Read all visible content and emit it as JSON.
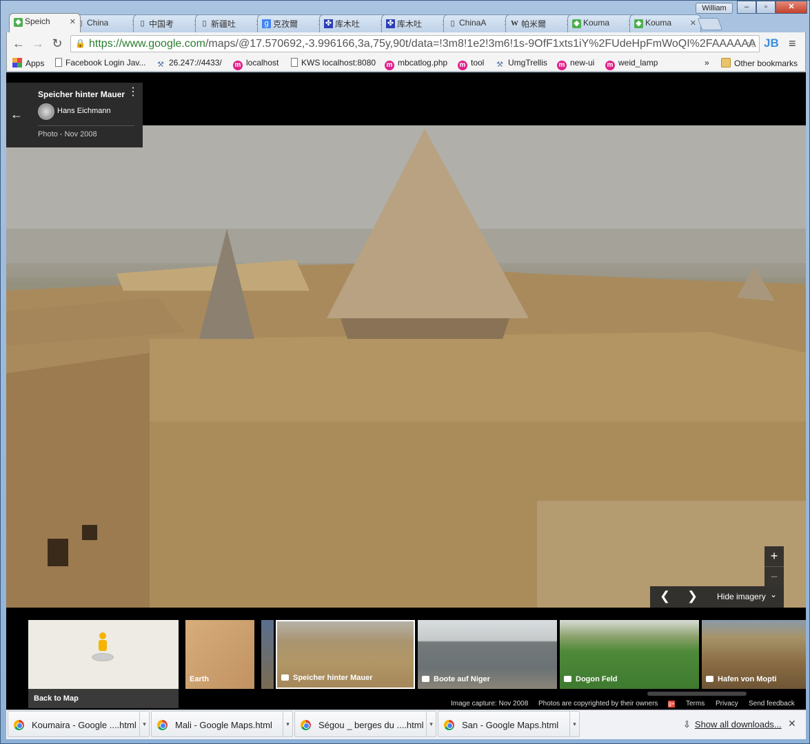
{
  "window": {
    "user": "William",
    "min": "–",
    "max": "▫",
    "close": "✕"
  },
  "tabs": [
    {
      "label": "Speich",
      "icon": "maps-icon",
      "active": true
    },
    {
      "label": "China",
      "icon": "page-icon"
    },
    {
      "label": "中国考",
      "icon": "page-icon"
    },
    {
      "label": "新疆吐",
      "icon": "page-icon"
    },
    {
      "label": "克孜爾",
      "icon": "google-icon"
    },
    {
      "label": "库木吐",
      "icon": "paw-icon"
    },
    {
      "label": "库木吐",
      "icon": "paw-icon"
    },
    {
      "label": "ChinaA",
      "icon": "page-icon"
    },
    {
      "label": "帕米爾",
      "icon": "wikipedia-icon"
    },
    {
      "label": "Kouma",
      "icon": "maps-icon"
    },
    {
      "label": "Kouma",
      "icon": "maps-icon"
    }
  ],
  "toolbar": {
    "url_host": "https://www.google.com",
    "url_path": "/maps/@17.570692,-3.996166,3a,75y,90t/data=!3m8!1e2!3m6!1s-9OfF1xts1iY%2FUdeHpFmWoQI%2FAAAAAA",
    "ext": "JB"
  },
  "bookmarks": [
    {
      "label": "Apps",
      "icon": "grid"
    },
    {
      "label": "Facebook Login Jav...",
      "icon": "pg"
    },
    {
      "label": "26.247://4433/",
      "icon": "tool"
    },
    {
      "label": "localhost",
      "icon": "m"
    },
    {
      "label": "KWS localhost:8080",
      "icon": "pg"
    },
    {
      "label": "mbcatlog.php",
      "icon": "m"
    },
    {
      "label": "tool",
      "icon": "m"
    },
    {
      "label": "UmgTrellis",
      "icon": "tool"
    },
    {
      "label": "new-ui",
      "icon": "m"
    },
    {
      "label": "weid_lamp",
      "icon": "m"
    }
  ],
  "bookmarks_more": "»",
  "bookmarks_other": "Other bookmarks",
  "photo": {
    "title": "Speicher hinter Mauer",
    "author": "Hans Eichmann",
    "date": "Photo - Nov 2008"
  },
  "controls": {
    "zoom_in": "+",
    "zoom_out": "−",
    "hide_imagery": "Hide imagery",
    "prev": "❮",
    "next": "❯",
    "chevron": "⌄"
  },
  "strip": {
    "back_to_map": "Back to Map",
    "cards": [
      {
        "label": "Earth"
      },
      {
        "label": "Speicher hinter Mauer"
      },
      {
        "label": "Boote auf Niger"
      },
      {
        "label": "Dogon Feld"
      },
      {
        "label": "Hafen von Mopti"
      }
    ]
  },
  "credits": {
    "capture": "Image capture: Nov 2008",
    "copyright": "Photos are copyrighted by their owners",
    "terms": "Terms",
    "privacy": "Privacy",
    "feedback": "Send feedback"
  },
  "downloads": [
    "Koumaira - Google ....html",
    "Mali - Google Maps.html",
    "Ségou _ berges du ....html",
    "San - Google Maps.html"
  ],
  "show_all": "Show all downloads...",
  "colors": {
    "secure": "#2a7d2e",
    "bookmark_m": "#e0218a",
    "peg": "#f4b400"
  }
}
